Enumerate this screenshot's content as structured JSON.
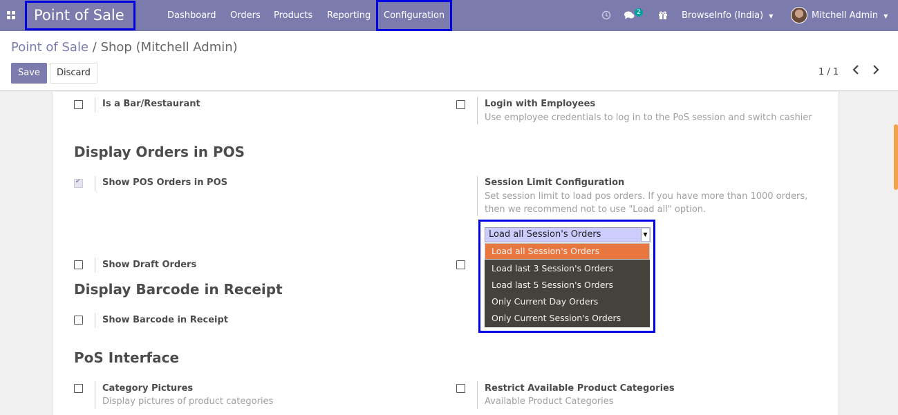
{
  "navbar": {
    "app_title": "Point of Sale",
    "menu": [
      "Dashboard",
      "Orders",
      "Products",
      "Reporting",
      "Configuration"
    ],
    "messages_badge": "2",
    "company": "BrowseInfo (India)",
    "user": "Mitchell Admin"
  },
  "breadcrumb": {
    "parent": "Point of Sale",
    "separator": "/",
    "current": "Shop (Mitchell Admin)"
  },
  "buttons": {
    "save": "Save",
    "discard": "Discard"
  },
  "pager": {
    "value": "1 / 1"
  },
  "settings": {
    "bar_restaurant": {
      "label": "Is a Bar/Restaurant",
      "checked": false
    },
    "login_employees": {
      "label": "Login with Employees",
      "description": "Use employee credentials to log in to the PoS session and switch cashier",
      "checked": false
    },
    "display_orders_section": "Display Orders in POS",
    "show_pos_orders": {
      "label": "Show POS Orders in POS",
      "checked": true
    },
    "session_limit": {
      "label": "Session Limit Configuration",
      "description_line1": "Set session limit to load pos orders. If you have more than 1000 orders,",
      "description_line2": "then we recommend not to use \"Load all\" option.",
      "selected": "Load all Session's Orders",
      "options": [
        "Load all Session's Orders",
        "Load last 3 Session's Orders",
        "Load last 5 Session's Orders",
        "Only Current Day Orders",
        "Only Current Session's Orders"
      ]
    },
    "show_draft_orders": {
      "label": "Show Draft Orders",
      "checked": false
    },
    "display_barcode_section": "Display Barcode in Receipt",
    "show_barcode": {
      "label": "Show Barcode in Receipt",
      "checked": false
    },
    "pos_interface_section": "PoS Interface",
    "category_pictures": {
      "label": "Category Pictures",
      "description": "Display pictures of product categories",
      "checked": false
    },
    "restrict_categories": {
      "label": "Restrict Available Product Categories",
      "description": "Available Product Categories",
      "checked": false
    }
  },
  "colors": {
    "navbar": "#7c7bad",
    "highlight_border": "#0000e0",
    "selected_option": "#e8773f",
    "dropdown_bg": "#44423b"
  }
}
